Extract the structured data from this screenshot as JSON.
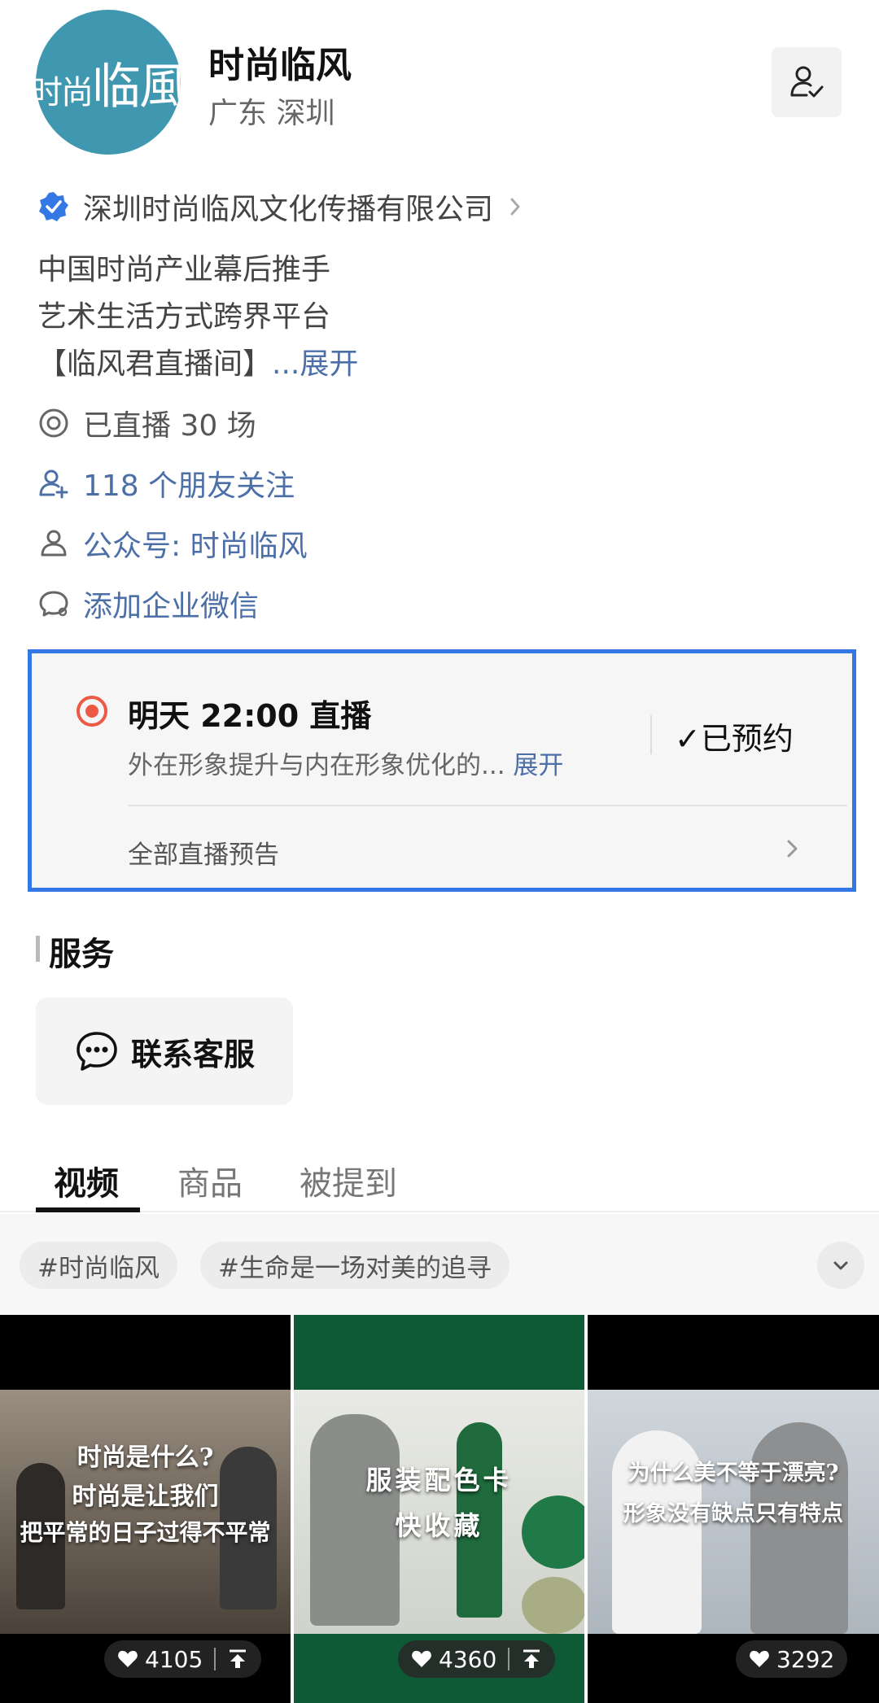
{
  "profile": {
    "avatar_text_small": "时尚",
    "avatar_text_big": "临風",
    "name": "时尚临风",
    "location": "广东 深圳"
  },
  "company": {
    "label": "深圳时尚临风文化传播有限公司"
  },
  "bio": {
    "line1": "中国时尚产业幕后推手",
    "line2": "艺术生活方式跨界平台",
    "line3": "【临风君直播间】",
    "more": "...展开"
  },
  "meta": {
    "live_count": "已直播 30 场",
    "friends": "118 个朋友关注",
    "official_account": "公众号: 时尚临风",
    "wecom": "添加企业微信"
  },
  "live_notice": {
    "title": "明天 22:00 直播",
    "desc": "外在形象提升与内在形象优化的...",
    "expand": "展开",
    "status": "✓已预约",
    "all_label": "全部直播预告"
  },
  "services": {
    "title": "服务",
    "contact_label": "联系客服"
  },
  "tabs": [
    "视频",
    "商品",
    "被提到"
  ],
  "tags": [
    "#时尚临风",
    "#生命是一场对美的追寻"
  ],
  "videos": [
    {
      "caption": [
        "时尚是什么?",
        "时尚是让我们",
        "把平常的日子过得不平常"
      ],
      "likes": "4105"
    },
    {
      "caption": [
        "服装配色卡",
        "快收藏"
      ],
      "likes": "4360"
    },
    {
      "caption": [
        "为什么美不等于漂亮?",
        "形象没有缺点只有特点"
      ],
      "likes": "3292"
    }
  ],
  "colors": {
    "accent_blue": "#3478e6",
    "link_blue": "#4c6fa8",
    "live_red": "#ec5a45",
    "avatar_teal": "#3f97b0"
  }
}
